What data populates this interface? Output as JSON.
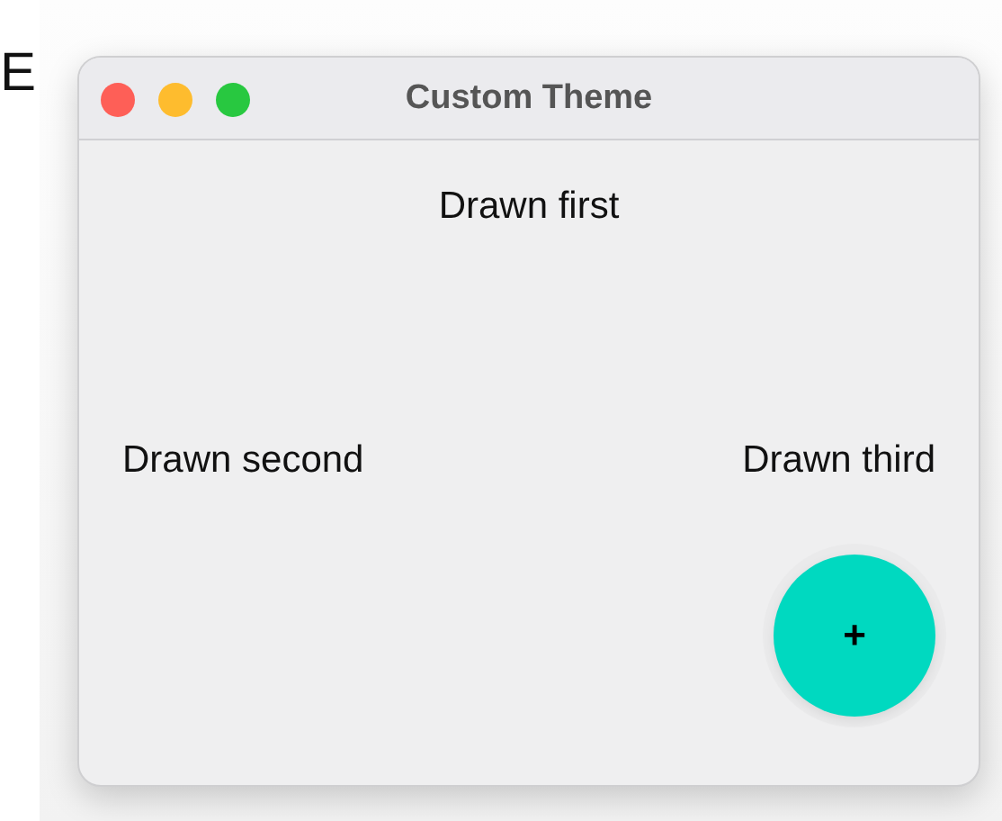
{
  "edge_text": "E",
  "window": {
    "title": "Custom Theme",
    "controls": [
      {
        "color": "#fe5f57"
      },
      {
        "color": "#febc2e"
      },
      {
        "color": "#28c840"
      }
    ]
  },
  "labels": [
    "Drawn first",
    "Drawn second",
    "Drawn third"
  ],
  "fab": {
    "label": "+",
    "color": "#00d9c0"
  }
}
